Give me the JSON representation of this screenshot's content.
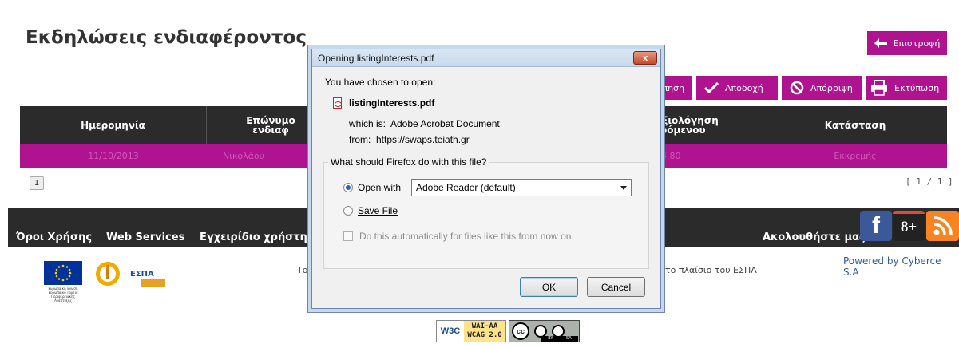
{
  "page": {
    "title": "Εκδηλώσεις ενδιαφέροντος"
  },
  "actions": {
    "back": "Επιστροφή",
    "evaluate": "πηση",
    "accept": "Αποδοχή",
    "reject": "Απόρριψη",
    "print": "Εκτύπωση"
  },
  "table": {
    "headers": [
      "Ημερομηνία",
      "Επώνυμο ενδιαφ",
      "Αξιολόγηση",
      "ερόμενου",
      "Κατάσταση"
    ],
    "row": {
      "date": "11/10/2013",
      "surname": "Νικολάου",
      "score": "4.80",
      "status": "Εκκρεμής"
    }
  },
  "pager": {
    "page": "1",
    "info": "[ 1 / 1 ]"
  },
  "footer": {
    "links": [
      "Όροι Χρήσης",
      "Web Services",
      "Εγχειρίδιο χρήστη"
    ],
    "follow": "Ακολουθήστε μας:",
    "text_left": "Το",
    "text_right": "στο πλαίσιο του ΕΣΠΑ",
    "powered": "Powered by Cyberce S.A",
    "eu_text": "Ευρωπαϊκή Ένωση Ευρωπαϊκό Ταμείο Περιφερειακής Ανάπτυξης",
    "espa": "ΕΣΠΑ"
  },
  "badges": {
    "w3c": "W3C",
    "wai_line1": "WAI-AA",
    "wai_line2": "WCAG 2.0",
    "cc": "cc",
    "by": "BY",
    "sa": "SA"
  },
  "social": {
    "facebook": "f",
    "googleplus": "8+"
  },
  "dialog": {
    "title": "Opening listingInterests.pdf",
    "close": "x",
    "intro": "You have chosen to open:",
    "filename": "listingInterests.pdf",
    "which_label": "which is:",
    "which_value": "Adobe Acrobat Document",
    "from_label": "from:",
    "from_value": "https://swaps.teiath.gr",
    "question": "What should Firefox do with this file?",
    "open_with_label": "Open with",
    "open_with_value": "Adobe Reader  (default)",
    "save_file_label": "Save File",
    "auto_label": "Do this automatically for files like this from now on.",
    "ok": "OK",
    "cancel": "Cancel"
  },
  "colors": {
    "accent": "#b0138f",
    "dark": "#2b2b2b",
    "link": "#2e5c9a"
  }
}
